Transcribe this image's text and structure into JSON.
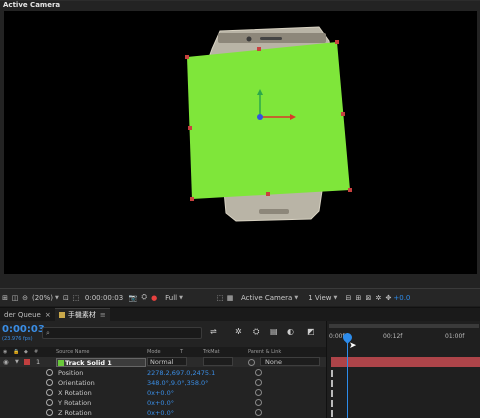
{
  "viewer": {
    "title": "Active Camera"
  },
  "viewer_toolbar": {
    "zoom": "(20%)",
    "timecode": "0:00:00:03",
    "resolution": "Full",
    "camera": "Active Camera",
    "views": "1 View",
    "exposure": "+0.0"
  },
  "tabs": [
    {
      "label": "der Queue"
    },
    {
      "label": "手機素材"
    }
  ],
  "timeline": {
    "timecode": "0:00:03",
    "fps": "(23.976 fps)",
    "search_placeholder": "",
    "columns": {
      "source_name": "Source Name",
      "mode": "Mode",
      "t": "T",
      "trkmat": "TrkMat",
      "parent": "Parent & Link"
    },
    "layer": {
      "index": "1",
      "name": "Track Solid 1",
      "mode": "Normal",
      "parent": "None"
    },
    "properties": [
      {
        "label": "Position",
        "value": "2278.2,697.0,2475.1"
      },
      {
        "label": "Orientation",
        "value": "348.0°,9.0°,358.0°"
      },
      {
        "label": "X Rotation",
        "value": "0x+0.0°"
      },
      {
        "label": "Y Rotation",
        "value": "0x+0.0°"
      },
      {
        "label": "Z Rotation",
        "value": "0x+0.0°"
      }
    ],
    "ruler": {
      "start": "0:00f",
      "mid": "00:12f",
      "end": "01:00f"
    }
  },
  "colors": {
    "solid": "#7fe63a",
    "layer_bar": "#ad4449",
    "accent_blue": "#2d8ceb",
    "label_green": "#6ac93b"
  }
}
